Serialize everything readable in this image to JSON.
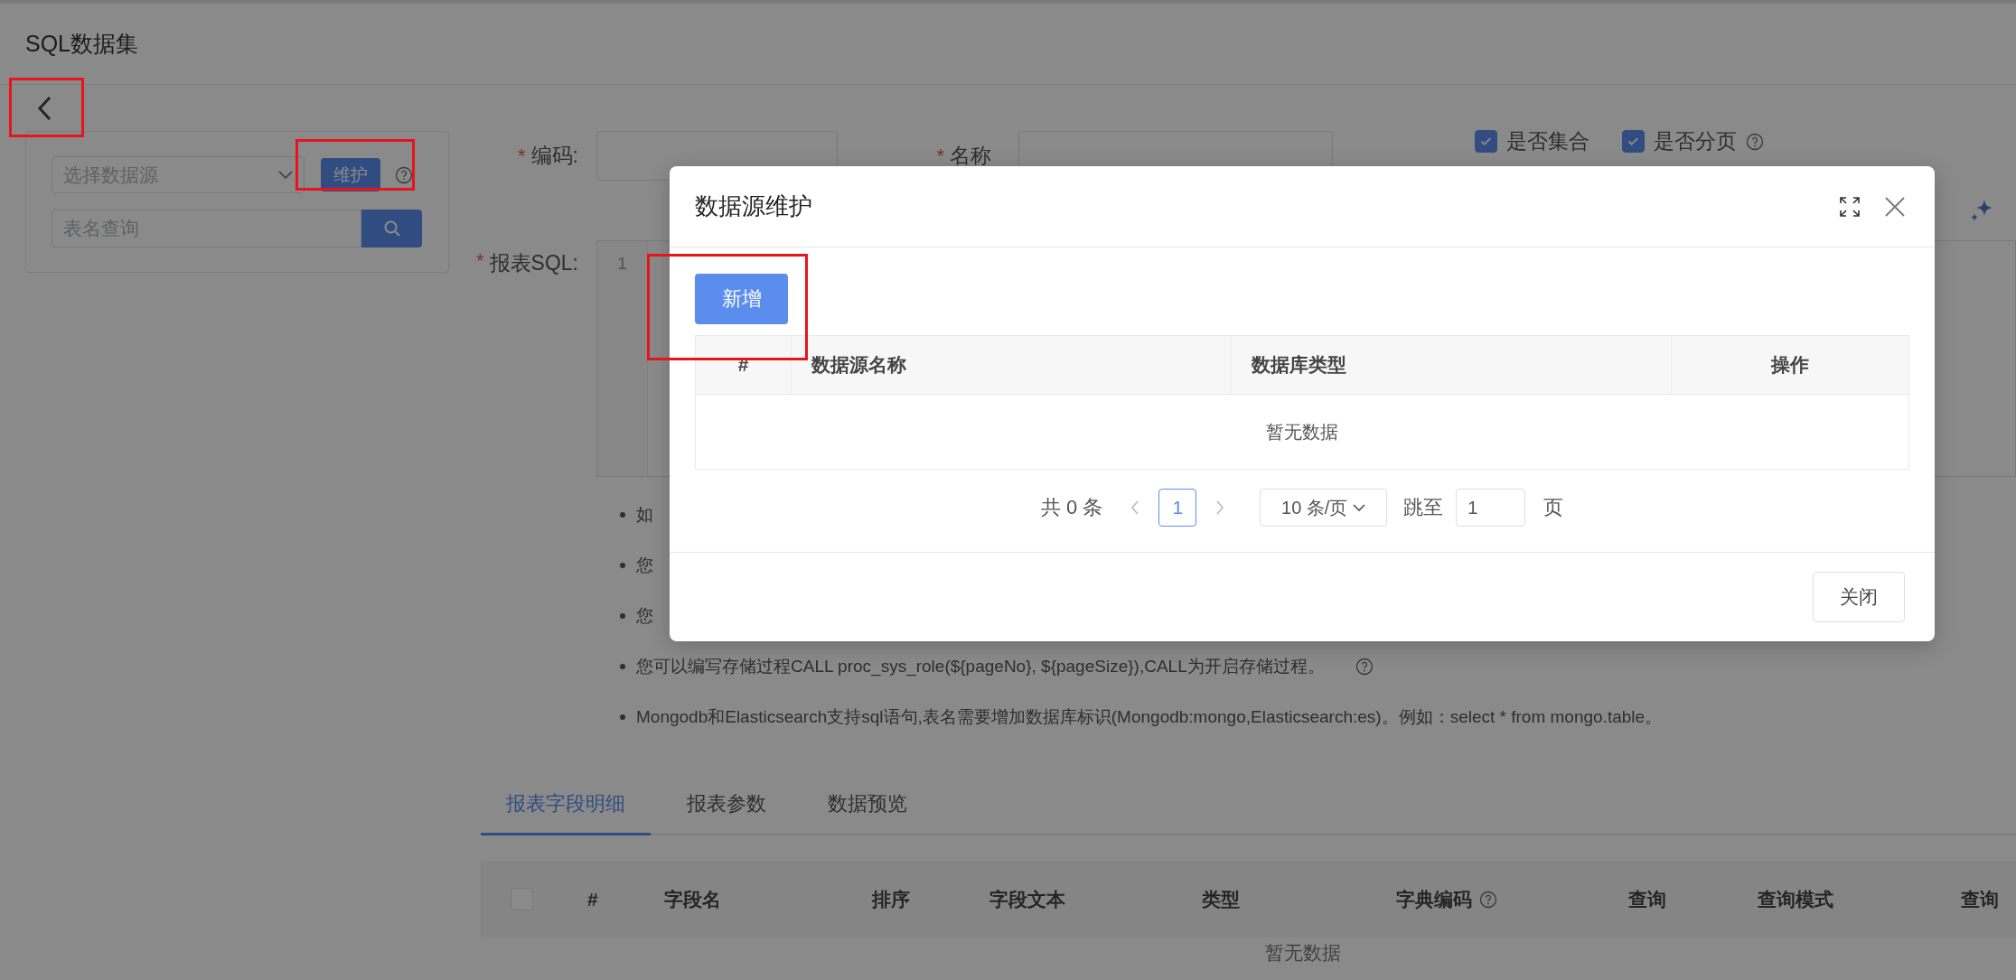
{
  "header": {
    "title": "SQL数据集"
  },
  "back_button": {
    "annotated": true
  },
  "source_panel": {
    "source_select": {
      "placeholder": "选择数据源"
    },
    "maintain_button": {
      "label": "维护",
      "annotated": true
    },
    "table_search": {
      "placeholder": "表名查询"
    }
  },
  "form": {
    "fields": [
      {
        "label": "编码:",
        "marker": "*"
      },
      {
        "label": "名称",
        "marker": "*"
      }
    ],
    "checkboxes": [
      {
        "label": "是否集合",
        "checked": true
      },
      {
        "label": "是否分页",
        "checked": true,
        "help": true
      }
    ],
    "sql": {
      "label": "报表SQL:",
      "marker": "*",
      "line_numbers": [
        "1"
      ]
    }
  },
  "notes": [
    {
      "text": "如"
    },
    {
      "text": "您"
    },
    {
      "text": "您"
    },
    {
      "text": "您可以编写存储过程CALL proc_sys_role(${pageNo}, ${pageSize}),CALL为开启存储过程。",
      "help": true
    },
    {
      "text": "Mongodb和Elasticsearch支持sql语句,表名需要增加数据库标识(Mongodb:mongo,Elasticsearch:es)。例如：select * from mongo.table。"
    }
  ],
  "tabs": [
    {
      "label": "报表字段明细",
      "selected": true
    },
    {
      "label": "报表参数",
      "selected": false
    },
    {
      "label": "数据预览",
      "selected": false
    }
  ],
  "field_table": {
    "columns": [
      {
        "kind": "checkbox",
        "checked": false
      },
      {
        "kind": "text",
        "label": "#"
      },
      {
        "kind": "text",
        "label": "字段名"
      },
      {
        "kind": "text",
        "label": "排序"
      },
      {
        "kind": "text",
        "label": "字段文本"
      },
      {
        "kind": "text",
        "label": "类型"
      },
      {
        "kind": "text",
        "label": "字典编码",
        "help": true
      },
      {
        "kind": "text",
        "label": "查询"
      },
      {
        "kind": "text",
        "label": "查询模式"
      },
      {
        "kind": "text",
        "label": "查询"
      }
    ],
    "empty_text": "暂无数据"
  },
  "dialog": {
    "title": "数据源维护",
    "add_button": {
      "label": "新增",
      "annotated": true
    },
    "table": {
      "columns": [
        "#",
        "数据源名称",
        "数据库类型",
        "操作"
      ],
      "empty_text": "暂无数据"
    },
    "pagination": {
      "total": "共 0 条",
      "pages": [
        {
          "label": "1",
          "selected": true
        }
      ],
      "page_size": "10 条/页",
      "jump_label": "跳至",
      "jump_value": "1",
      "page_suffix": "页"
    },
    "close_button": "关闭"
  }
}
